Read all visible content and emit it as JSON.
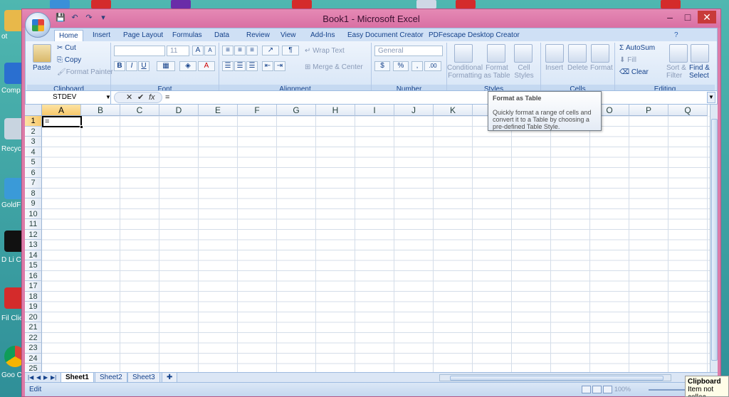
{
  "window": {
    "title": "Book1 - Microsoft Excel",
    "controls": [
      "–",
      "□",
      "✕"
    ]
  },
  "qat": {
    "save": "💾",
    "undo": "↶",
    "redo": "↷",
    "more": "▾"
  },
  "ribbon": {
    "tabs": [
      "Home",
      "Insert",
      "Page Layout",
      "Formulas",
      "Data",
      "Review",
      "View",
      "Add-Ins",
      "Easy Document Creator",
      "PDFescape Desktop Creator"
    ],
    "active_tab": "Home",
    "groups": {
      "clipboard": {
        "label": "Clipboard",
        "paste": "Paste",
        "cut": "Cut",
        "copy": "Copy",
        "format_painter": "Format Painter"
      },
      "font": {
        "label": "Font",
        "font_size": "11",
        "bold": "B",
        "italic": "I",
        "underline": "U",
        "grow": "A",
        "shrink": "A"
      },
      "alignment": {
        "label": "Alignment",
        "wrap_text": "Wrap Text",
        "merge_center": "Merge & Center"
      },
      "number": {
        "label": "Number",
        "format": "General",
        "currency": "$",
        "percent": "%",
        "comma": ","
      },
      "styles": {
        "label": "Styles",
        "conditional": "Conditional",
        "conditional2": "Formatting",
        "format_as": "Format",
        "format_as2": "as Table",
        "cell": "Cell",
        "cell2": "Styles"
      },
      "cells": {
        "label": "Cells",
        "insert": "Insert",
        "delete": "Delete",
        "format": "Format"
      },
      "editing": {
        "label": "Editing",
        "autosum": "AutoSum",
        "fill": "Fill",
        "clear": "Clear",
        "sort": "Sort &",
        "sort2": "Filter",
        "find": "Find &",
        "find2": "Select"
      }
    }
  },
  "formula_bar": {
    "name_box": "STDEV",
    "cancel": "✕",
    "enter": "✔",
    "fx": "fx",
    "value": "="
  },
  "grid": {
    "columns": [
      "A",
      "B",
      "C",
      "D",
      "E",
      "F",
      "G",
      "H",
      "I",
      "J",
      "K",
      "L",
      "M",
      "N",
      "O",
      "P",
      "Q"
    ],
    "rows": [
      "1",
      "2",
      "3",
      "4",
      "5",
      "6",
      "7",
      "8",
      "9",
      "10",
      "11",
      "12",
      "13",
      "14",
      "15",
      "16",
      "17",
      "18",
      "19",
      "20",
      "21",
      "22",
      "23",
      "24",
      "25"
    ],
    "active_cell_value": "="
  },
  "sheets": [
    "Sheet1",
    "Sheet2",
    "Sheet3"
  ],
  "status": {
    "mode": "Edit",
    "zoom": "100%"
  },
  "tooltip": {
    "title": "Format as Table",
    "body": "Quickly format a range of cells and convert it to a Table by choosing a pre-defined Table Style."
  },
  "clipboard_popup": {
    "title": "Clipboard",
    "text": "Item not collec"
  },
  "desktop": {
    "labels": [
      "ot",
      "Comp",
      "Recycl",
      "GoldF",
      "D Li Conn",
      "Fil Clie",
      "Goo Chro"
    ]
  },
  "colors": {
    "window_frame": "#dd7ba8",
    "ribbon": "#dbe7f6",
    "selected_header": "#f8c96b"
  }
}
